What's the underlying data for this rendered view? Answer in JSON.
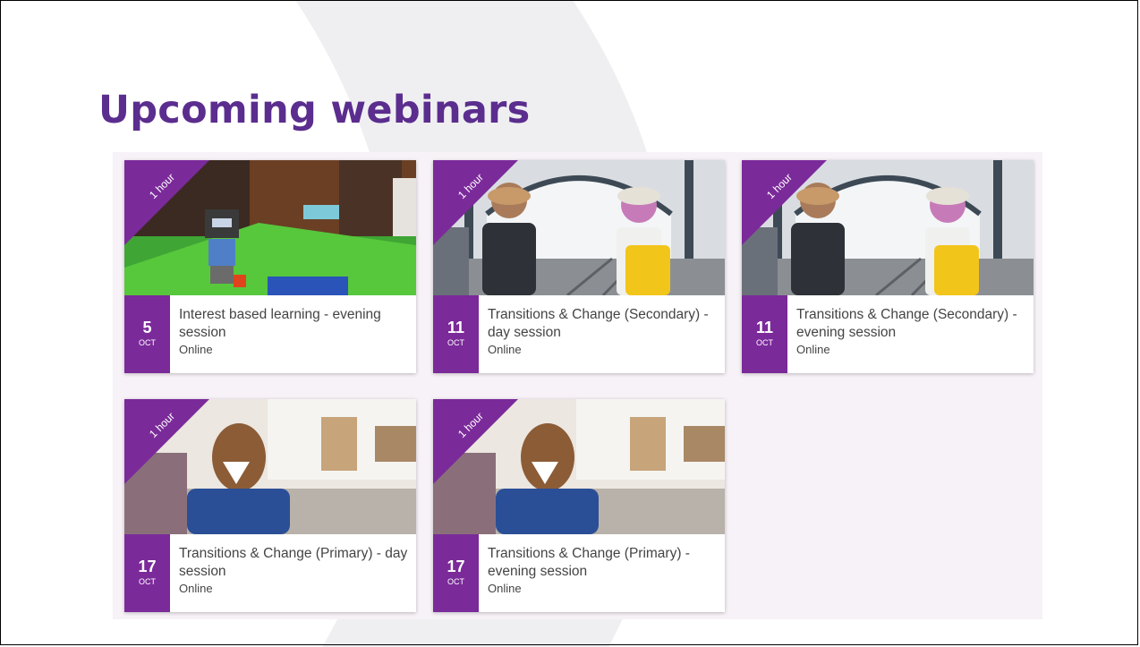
{
  "page": {
    "title": "Upcoming webinars"
  },
  "colors": {
    "brand_purple": "#7b2a9a",
    "title_purple": "#5b2d8e",
    "panel_bg": "#f7f2f7"
  },
  "cards": [
    {
      "duration": "1 hour",
      "day": "5",
      "month": "OCT",
      "title": "Interest based learning - evening session",
      "location": "Online",
      "image": "lego-minecraft-photo"
    },
    {
      "duration": "1 hour",
      "day": "11",
      "month": "OCT",
      "title": "Transitions & Change (Secondary) - day session",
      "location": "Online",
      "image": "train-station-travellers-photo"
    },
    {
      "duration": "1 hour",
      "day": "11",
      "month": "OCT",
      "title": "Transitions & Change (Secondary) - evening session",
      "location": "Online",
      "image": "train-station-travellers-photo"
    },
    {
      "duration": "1 hour",
      "day": "17",
      "month": "OCT",
      "title": "Transitions & Change (Primary) - day session",
      "location": "Online",
      "image": "child-with-backpack-photo"
    },
    {
      "duration": "1 hour",
      "day": "17",
      "month": "OCT",
      "title": "Transitions & Change (Primary) - evening session",
      "location": "Online",
      "image": "child-with-backpack-photo"
    }
  ]
}
